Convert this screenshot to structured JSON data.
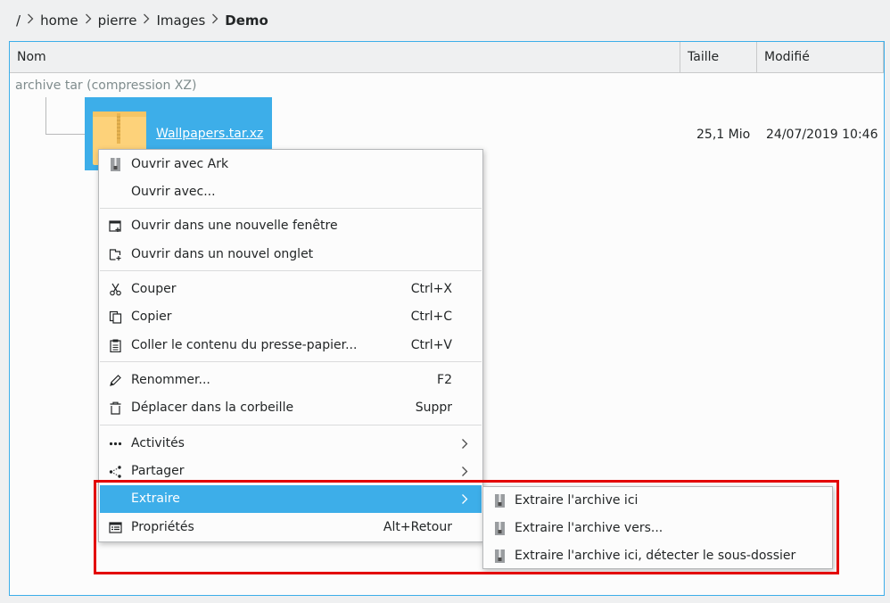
{
  "breadcrumb": {
    "root": "/",
    "items": [
      "home",
      "pierre",
      "Images"
    ],
    "current": "Demo"
  },
  "columns": {
    "name": "Nom",
    "size": "Taille",
    "modified": "Modifié"
  },
  "group_label": "archive tar (compression XZ)",
  "file": {
    "name": "Wallpapers.tar.xz",
    "size": "25,1 Mio",
    "modified": "24/07/2019 10:46"
  },
  "context_menu": {
    "open_with_ark": "Ouvrir avec Ark",
    "open_with": "Ouvrir avec...",
    "open_new_window": "Ouvrir dans une nouvelle fenêtre",
    "open_new_tab": "Ouvrir dans un nouvel onglet",
    "cut": "Couper",
    "cut_shortcut": "Ctrl+X",
    "copy": "Copier",
    "copy_shortcut": "Ctrl+C",
    "paste": "Coller le contenu du presse-papier...",
    "paste_shortcut": "Ctrl+V",
    "rename": "Renommer...",
    "rename_shortcut": "F2",
    "trash": "Déplacer dans la corbeille",
    "trash_shortcut": "Suppr",
    "activities": "Activités",
    "share": "Partager",
    "extract": "Extraire",
    "properties": "Propriétés",
    "properties_shortcut": "Alt+Retour"
  },
  "submenu": {
    "extract_here": "Extraire l'archive ici",
    "extract_to": "Extraire l'archive vers...",
    "extract_here_autodetect": "Extraire l'archive ici, détecter le sous-dossier"
  },
  "colors": {
    "accent": "#3daee9",
    "highlight_box": "#e30000",
    "folder": "#fdd27a"
  },
  "icons": {
    "ark": "archive-zipper-icon",
    "new_window": "window-new-icon",
    "new_tab": "tab-new-icon",
    "cut": "scissors-icon",
    "copy": "copy-icon",
    "paste": "clipboard-icon",
    "rename": "pencil-icon",
    "trash": "trash-icon",
    "activities": "activities-icon",
    "share": "share-icon",
    "properties": "properties-icon",
    "chevron": "chevron-right-icon"
  }
}
